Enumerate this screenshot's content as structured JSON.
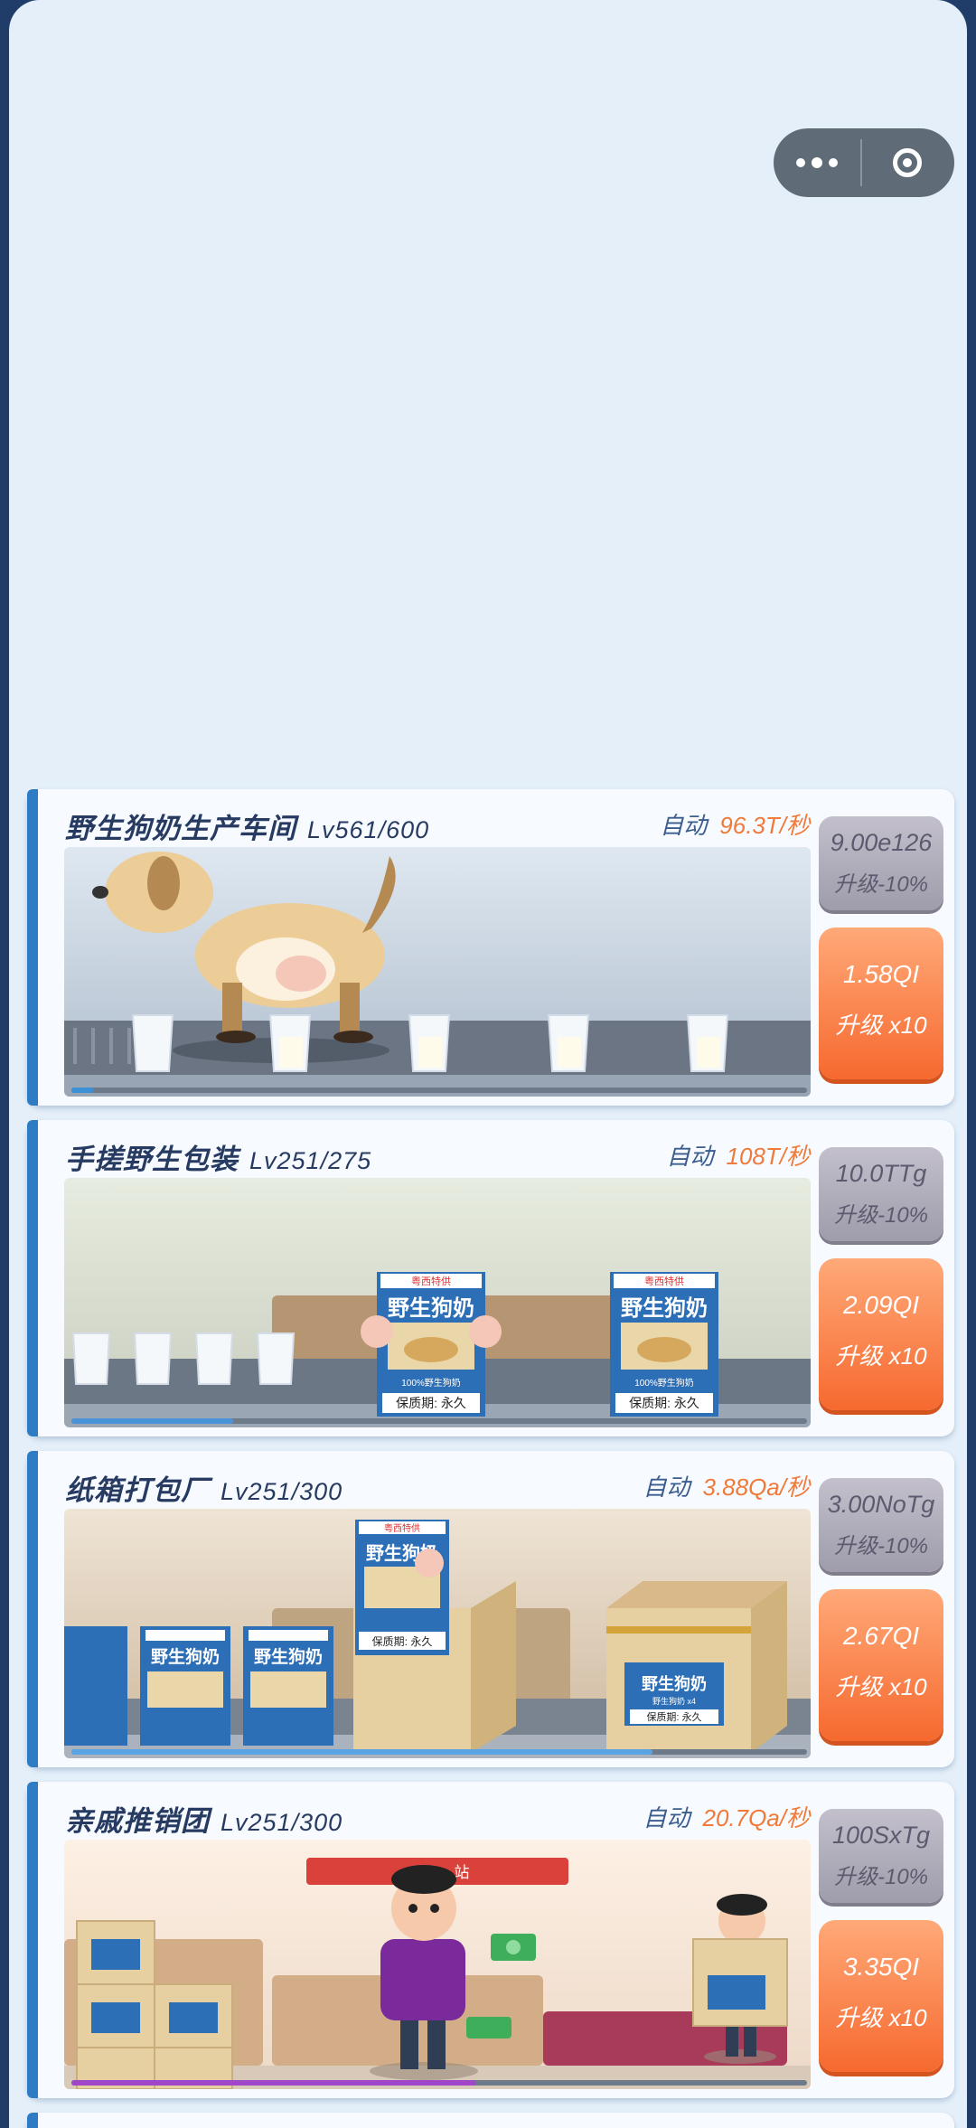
{
  "capsule": {
    "more_icon": "more-dots-icon",
    "close_icon": "record-circle-icon"
  },
  "cards": [
    {
      "name": "野生狗奶生产车间",
      "level": "Lv561/600",
      "auto_label": "自动",
      "rate": "96.3T/秒",
      "discount_cost": "9.00e126",
      "discount_label": "升级-10%",
      "upgrade_cost": "1.58QI",
      "upgrade_label": "升级 x10",
      "progress": 0.03
    },
    {
      "name": "手搓野生包装",
      "level": "Lv251/275",
      "auto_label": "自动",
      "rate": "108T/秒",
      "discount_cost": "10.0TTg",
      "discount_label": "升级-10%",
      "upgrade_cost": "2.09QI",
      "upgrade_label": "升级 x10",
      "progress": 0.22
    },
    {
      "name": "纸箱打包厂",
      "level": "Lv251/300",
      "auto_label": "自动",
      "rate": "3.88Qa/秒",
      "discount_cost": "3.00NoTg",
      "discount_label": "升级-10%",
      "upgrade_cost": "2.67QI",
      "upgrade_label": "升级 x10",
      "progress": 0.79
    },
    {
      "name": "亲戚推销团",
      "level": "Lv251/300",
      "auto_label": "自动",
      "rate": "20.7Qa/秒",
      "discount_cost": "100SxTg",
      "discount_label": "升级-10%",
      "upgrade_cost": "3.35QI",
      "upgrade_label": "升级 x10",
      "progress": 0.55
    }
  ],
  "box_labels": {
    "brand": "野生狗奶",
    "tag": "粤西特供",
    "sub": "100%野生狗奶",
    "shelf": "保质期: 永久",
    "sub2": "野生狗奶 x4"
  },
  "sign_text": "站",
  "colors": {
    "accent": "#2f7cc5",
    "orange": "#f6692f",
    "rate": "#f07a3a",
    "grey_btn": "#aeabb9"
  }
}
